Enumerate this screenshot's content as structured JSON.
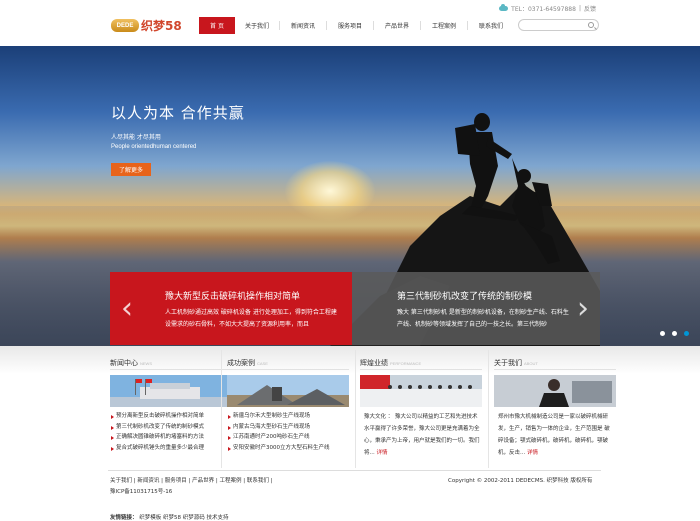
{
  "topbar": {
    "phone": "TEL：0371-64597888",
    "sep": "|",
    "link": "反馈"
  },
  "logo": {
    "mark": "DEDE",
    "name": "织梦58"
  },
  "nav": [
    "首 页",
    "关于我们",
    "新闻资讯",
    "服务项目",
    "产品世界",
    "工程案例",
    "联系我们"
  ],
  "search": {
    "placeholder": ""
  },
  "hero": {
    "title": "以人为本 合作共赢",
    "sub_cn": "人尽其能  才尽其用",
    "sub_en": "People orientedhuman centered",
    "more": "了解更多"
  },
  "slides": [
    {
      "title": "豫大新型反击破碎机操作相对简单",
      "desc": "人工机制砂通过高效 破碎机设备 进行处理加工，得到符合工程建设需求的砂石骨料，不如大大提高了资源利用率，而且"
    },
    {
      "title": "第三代制砂机改变了传统的制砂模",
      "desc": "豫大 第三代制砂机 是新型的制砂机设备，在制砂生产线、石料生产线、机制砂等领域发挥了自己的一技之长。第三代制砂"
    }
  ],
  "columns": {
    "news": {
      "title": "新闻中心",
      "en": "NEWS",
      "items": [
        "预分离新型反击破碎机操作相对简单",
        "第三代制砂机改变了传统的制砂模式",
        "正确解决圆锥破碎机的堵塞料的方法",
        "复合式破碎机锤头的重量多少最合理"
      ]
    },
    "cases": {
      "title": "成功案例",
      "en": "CASE",
      "items": [
        "新疆乌尔禾大型制砂生产线现场",
        "内蒙古乌海大型砂石生产线现场",
        "江苏南通时产200吨砂石生产线",
        "安阳安徽时产3000立方大型石料生产线"
      ]
    },
    "culture": {
      "title": "辉煌业绩",
      "en": "PERFORMANCE",
      "text": "豫大文化 ： 豫大公司以精益的工艺和先进技术水平赢得了许多荣誉，豫大公司更是充满着为全心，秉承产为上帝，用户就是我们的一切。我们将...",
      "more": "详情"
    },
    "about": {
      "title": "关于我们",
      "en": "ABOUT",
      "text": "郑州市豫大机械制造公司是一家以破碎机械研发，生产，销售为一体的企业，生产范围是 破碎设备；颚式破碎机，破碎机，破碎机，颚破机，反击...",
      "more": "详情"
    }
  },
  "footer": {
    "links": [
      "关于我们",
      "新闻资讯",
      "服务项目",
      "产品世界",
      "工程案例",
      "联系我们"
    ],
    "icp": "豫ICP备11031715号-16",
    "copyright": "Copyright © 2002-2011 DEDECMS. 织梦科技 版权所有",
    "friends_label": "友情链接：",
    "friends": [
      "织梦模板",
      "织梦58",
      "织梦源码",
      "技术支持"
    ]
  }
}
